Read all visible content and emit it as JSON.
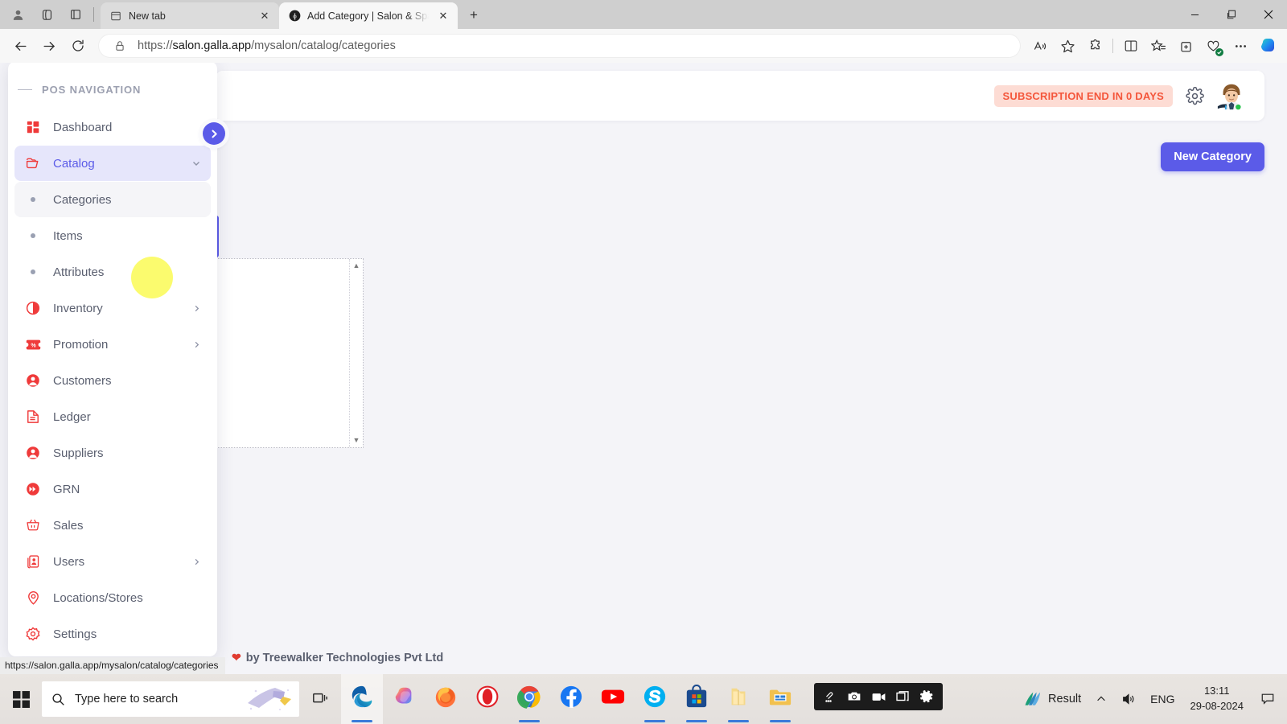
{
  "browser": {
    "tabs": [
      {
        "title": "New tab",
        "active": false,
        "favicon": "newtab-icon"
      },
      {
        "title": "Add Category | Salon & Spa Mana",
        "active": true,
        "favicon": "site-icon"
      }
    ],
    "new_tab_label": "+",
    "url_protocol": "https://",
    "url_host": "salon.galla.app",
    "url_path": "/mysalon/catalog/categories",
    "url_full": "https://salon.galla.app/mysalon/catalog/categories",
    "toolbar_icons": [
      "back-icon",
      "forward-icon",
      "refresh-icon",
      "lock-icon",
      "read-aloud-icon",
      "favorite-star-icon",
      "extensions-icon",
      "split-screen-icon",
      "favorites-list-icon",
      "collections-icon",
      "browser-essentials-icon",
      "more-options-icon",
      "copilot-icon"
    ],
    "window_controls": [
      "minimize",
      "maximize",
      "close"
    ]
  },
  "sidebar": {
    "title": "POS NAVIGATION",
    "toggle_icon": "chevron-right-icon",
    "items": [
      {
        "label": "Dashboard",
        "icon": "dashboard-icon",
        "type": "link",
        "state": ""
      },
      {
        "label": "Catalog",
        "icon": "folder-icon",
        "type": "group",
        "state": "active",
        "chevron": "chevron-down-icon"
      },
      {
        "label": "Categories",
        "icon": "bullet-dot",
        "type": "sub",
        "state": "selected"
      },
      {
        "label": "Items",
        "icon": "bullet-dot",
        "type": "sub",
        "state": ""
      },
      {
        "label": "Attributes",
        "icon": "bullet-dot",
        "type": "sub",
        "state": ""
      },
      {
        "label": "Inventory",
        "icon": "inventory-icon",
        "type": "group",
        "state": "",
        "chevron": "chevron-right-icon"
      },
      {
        "label": "Promotion",
        "icon": "ticket-icon",
        "type": "group",
        "state": "",
        "chevron": "chevron-right-icon"
      },
      {
        "label": "Customers",
        "icon": "user-circle-icon",
        "type": "link",
        "state": ""
      },
      {
        "label": "Ledger",
        "icon": "document-icon",
        "type": "link",
        "state": ""
      },
      {
        "label": "Suppliers",
        "icon": "user-circle-icon",
        "type": "link",
        "state": ""
      },
      {
        "label": "GRN",
        "icon": "forward-circle-icon",
        "type": "link",
        "state": ""
      },
      {
        "label": "Sales",
        "icon": "basket-icon",
        "type": "link",
        "state": ""
      },
      {
        "label": "Users",
        "icon": "users-card-icon",
        "type": "group",
        "state": "",
        "chevron": "chevron-right-icon"
      },
      {
        "label": "Locations/Stores",
        "icon": "location-pin-icon",
        "type": "link",
        "state": ""
      },
      {
        "label": "Settings",
        "icon": "gear-icon",
        "type": "link",
        "state": ""
      }
    ]
  },
  "app": {
    "subscription_badge": "SUBSCRIPTION END IN 0 DAYS",
    "settings_icon": "gear-icon",
    "avatar_icon": "user-avatar",
    "new_category_button": "New Category",
    "footer_prefix_icon": "heart-icon",
    "footer_text": "by Treewalker Technologies Pvt Ltd",
    "scroll_up_arrow": "▲",
    "scroll_down_arrow": "▼"
  },
  "status_bar": {
    "link_preview": "https://salon.galla.app/mysalon/catalog/categories"
  },
  "taskbar": {
    "start_icon": "windows-start-icon",
    "search_placeholder": "Type here to search",
    "search_icon": "search-icon",
    "taskview_icon": "task-view-icon",
    "apps": [
      {
        "name": "Microsoft Edge",
        "icon": "edge-icon",
        "running": true,
        "focused": true
      },
      {
        "name": "Copilot",
        "icon": "copilot-icon",
        "running": false,
        "focused": false
      },
      {
        "name": "Mozilla Firefox",
        "icon": "firefox-icon",
        "running": false,
        "focused": false
      },
      {
        "name": "Opera",
        "icon": "opera-icon",
        "running": false,
        "focused": false
      },
      {
        "name": "Google Chrome",
        "icon": "chrome-icon",
        "running": true,
        "focused": false
      },
      {
        "name": "Facebook",
        "icon": "facebook-icon",
        "running": false,
        "focused": false
      },
      {
        "name": "YouTube",
        "icon": "youtube-icon",
        "running": false,
        "focused": false
      },
      {
        "name": "Skype",
        "icon": "skype-icon",
        "running": true,
        "focused": false
      },
      {
        "name": "Microsoft Store",
        "icon": "store-icon",
        "running": true,
        "focused": false
      },
      {
        "name": "Folder",
        "icon": "folder-yellow-icon",
        "running": true,
        "focused": false
      },
      {
        "name": "File Explorer",
        "icon": "explorer-icon",
        "running": true,
        "focused": false
      }
    ],
    "recorder_buttons": [
      "screenshot-settings-icon",
      "camera-icon",
      "video-camera-icon",
      "window-capture-icon",
      "gear-icon"
    ],
    "tray_app_label": "Result",
    "tray_app_icon": "result-icon",
    "tray_overflow_icon": "chevron-up-icon",
    "tray_volume_icon": "speaker-icon",
    "tray_language": "ENG",
    "clock_time": "13:11",
    "clock_date": "29-08-2024",
    "notification_icon": "notification-icon"
  },
  "colors": {
    "accent": "#5b5be8",
    "sidebar_icon": "#ef3a3a",
    "badge_bg": "#fddcd4",
    "badge_text": "#f4563b",
    "page_bg": "#f4f4f8",
    "highlight": "#fbfb62"
  }
}
